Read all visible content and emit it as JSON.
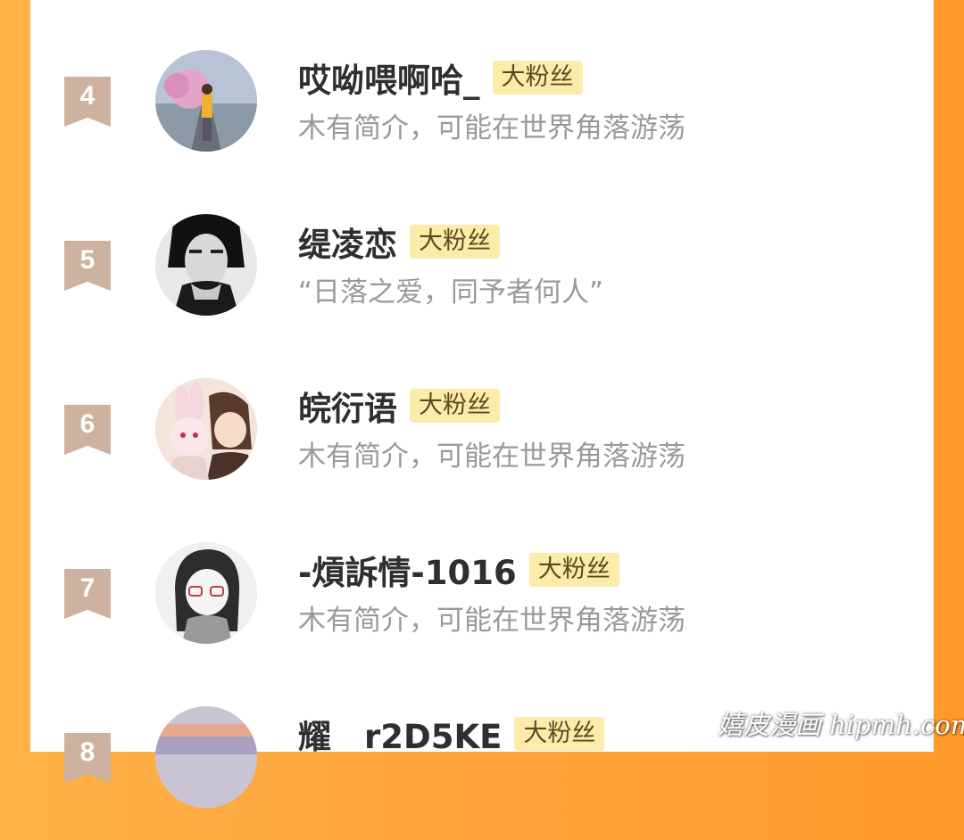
{
  "fans": [
    {
      "rank": "4",
      "name": "哎呦喂啊哈_",
      "badge": "大粉丝",
      "bio": "木有简介，可能在世界角落游荡"
    },
    {
      "rank": "5",
      "name": "缇凌恋",
      "badge": "大粉丝",
      "bio": "“日落之爱，同予者何人”"
    },
    {
      "rank": "6",
      "name": "皖衍语",
      "badge": "大粉丝",
      "bio": "木有简介，可能在世界角落游荡"
    },
    {
      "rank": "7",
      "name": "-熕訴情-1016",
      "badge": "大粉丝",
      "bio": "木有简介，可能在世界角落游荡"
    },
    {
      "rank": "8",
      "name": "耀　r2D5KE",
      "badge": "大粉丝",
      "bio": ""
    }
  ],
  "watermark": "嬉皮漫画 hipmh.com"
}
